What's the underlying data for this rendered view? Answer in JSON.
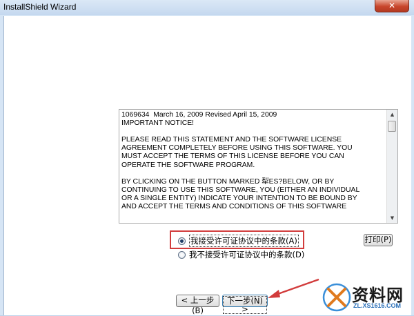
{
  "window": {
    "title": "InstallShield Wizard",
    "close_glyph": "✕"
  },
  "license": {
    "lines": [
      "1069634  March 16, 2009 Revised April 15, 2009",
      "IMPORTANT NOTICE!",
      "",
      "PLEASE READ THIS STATEMENT AND THE SOFTWARE LICENSE",
      "AGREEMENT COMPLETELY BEFORE USING THIS SOFTWARE. YOU",
      "MUST ACCEPT THE TERMS OF THIS LICENSE BEFORE YOU CAN",
      "OPERATE THE SOFTWARE PROGRAM.",
      "",
      "BY CLICKING ON THE BUTTON MARKED 犁ES?BELOW, OR BY",
      "CONTINUING TO USE THIS SOFTWARE, YOU (EITHER AN INDIVIDUAL",
      "OR A SINGLE ENTITY) INDICATE YOUR INTENTION TO BE BOUND BY",
      "AND ACCEPT THE TERMS AND CONDITIONS OF THIS SOFTWARE"
    ]
  },
  "options": {
    "accept_label": "我接受许可证协议中的条款(A)",
    "decline_label": "我不接受许可证协议中的条款(D)",
    "selected": "accept"
  },
  "buttons": {
    "print": "打印(P)",
    "back": "< 上一步(B)",
    "next": "下一步(N) >"
  },
  "watermark": {
    "text": "资料网",
    "url": "ZL.XS1616.COM"
  },
  "colors": {
    "highlight": "#d23c3c",
    "arrow": "#d23c3c"
  }
}
